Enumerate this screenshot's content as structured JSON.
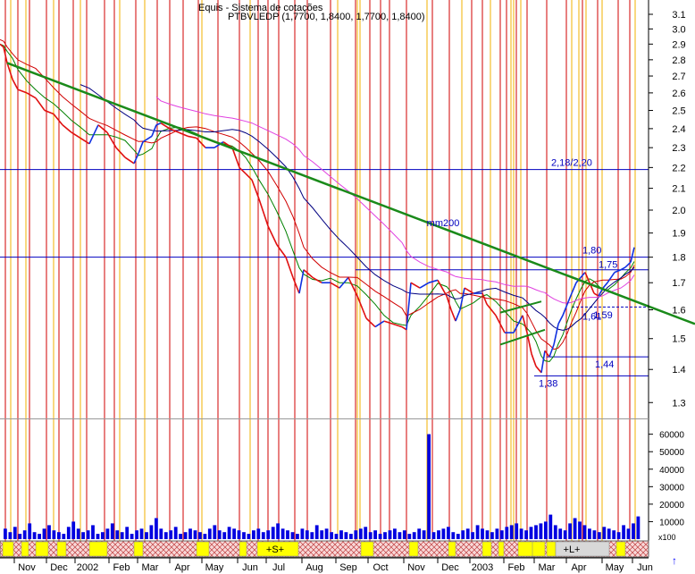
{
  "header": {
    "line1": "Equis - Sistema de cotações",
    "line2": "PTBVLEDP (1,7700, 1,8400, 1,7700, 1,8400)"
  },
  "chart_data": [
    {
      "type": "line",
      "title": "",
      "x_ticks": [
        "Nov",
        "Dec",
        "2002",
        "Feb",
        "Mar",
        "Apr",
        "May",
        "Jun",
        "Jul",
        "Aug",
        "Sep",
        "Oct",
        "Nov",
        "Dec",
        "2003",
        "Feb",
        "Mar",
        "Apr",
        "May",
        "Jun"
      ],
      "y_ticks": [
        "3.1",
        "3.0",
        "2.9",
        "2.8",
        "2.7",
        "2.6",
        "2.5",
        "2.4",
        "2.3",
        "2.2",
        "2.1",
        "2.0",
        "1.9",
        "1.8",
        "1.7",
        "1.6",
        "1.5",
        "1.4",
        "1.3"
      ],
      "ylim": [
        1.28,
        3.15
      ],
      "log_scale": true,
      "series": [
        {
          "color": "#e01010",
          "role": "price (down days)"
        },
        {
          "color": "#1030e0",
          "role": "price (up days)"
        },
        {
          "name": "mm200",
          "color": "#e040e0"
        },
        {
          "color": "#000080"
        },
        {
          "color": "#e01010"
        },
        {
          "color": "#008000"
        }
      ],
      "price_points": [
        [
          0,
          2.9
        ],
        [
          4,
          2.88
        ],
        [
          8,
          2.78
        ],
        [
          14,
          2.68
        ],
        [
          20,
          2.62
        ],
        [
          30,
          2.6
        ],
        [
          40,
          2.57
        ],
        [
          50,
          2.5
        ],
        [
          60,
          2.48
        ],
        [
          70,
          2.42
        ],
        [
          80,
          2.38
        ],
        [
          90,
          2.35
        ],
        [
          100,
          2.32
        ],
        [
          110,
          2.42
        ],
        [
          120,
          2.38
        ],
        [
          130,
          2.3
        ],
        [
          140,
          2.25
        ],
        [
          150,
          2.22
        ],
        [
          155,
          2.27
        ],
        [
          160,
          2.33
        ],
        [
          170,
          2.36
        ],
        [
          175,
          2.42
        ],
        [
          180,
          2.43
        ],
        [
          190,
          2.4
        ],
        [
          200,
          2.38
        ],
        [
          210,
          2.36
        ],
        [
          220,
          2.35
        ],
        [
          230,
          2.3
        ],
        [
          240,
          2.3
        ],
        [
          250,
          2.33
        ],
        [
          260,
          2.3
        ],
        [
          268,
          2.2
        ],
        [
          275,
          2.17
        ],
        [
          282,
          2.14
        ],
        [
          290,
          2.05
        ],
        [
          300,
          1.93
        ],
        [
          310,
          1.85
        ],
        [
          320,
          1.8
        ],
        [
          328,
          1.72
        ],
        [
          335,
          1.66
        ],
        [
          340,
          1.75
        ],
        [
          350,
          1.72
        ],
        [
          360,
          1.7
        ],
        [
          370,
          1.7
        ],
        [
          380,
          1.68
        ],
        [
          390,
          1.72
        ],
        [
          400,
          1.65
        ],
        [
          410,
          1.57
        ],
        [
          420,
          1.54
        ],
        [
          430,
          1.56
        ],
        [
          440,
          1.55
        ],
        [
          450,
          1.54
        ],
        [
          455,
          1.53
        ],
        [
          460,
          1.7
        ],
        [
          470,
          1.68
        ],
        [
          480,
          1.7
        ],
        [
          490,
          1.71
        ],
        [
          500,
          1.65
        ],
        [
          505,
          1.6
        ],
        [
          510,
          1.56
        ],
        [
          515,
          1.6
        ],
        [
          520,
          1.68
        ],
        [
          530,
          1.66
        ],
        [
          540,
          1.66
        ],
        [
          545,
          1.62
        ],
        [
          555,
          1.58
        ],
        [
          565,
          1.52
        ],
        [
          575,
          1.52
        ],
        [
          585,
          1.58
        ],
        [
          590,
          1.52
        ],
        [
          595,
          1.45
        ],
        [
          600,
          1.41
        ],
        [
          606,
          1.39
        ],
        [
          610,
          1.46
        ],
        [
          615,
          1.44
        ],
        [
          620,
          1.48
        ],
        [
          625,
          1.55
        ],
        [
          630,
          1.58
        ],
        [
          635,
          1.62
        ],
        [
          640,
          1.66
        ],
        [
          645,
          1.7
        ],
        [
          650,
          1.72
        ],
        [
          655,
          1.74
        ],
        [
          660,
          1.7
        ],
        [
          665,
          1.66
        ],
        [
          670,
          1.65
        ],
        [
          675,
          1.68
        ],
        [
          680,
          1.7
        ],
        [
          688,
          1.74
        ],
        [
          695,
          1.75
        ],
        [
          700,
          1.76
        ],
        [
          706,
          1.78
        ],
        [
          710,
          1.84
        ]
      ],
      "trendlines": [
        {
          "from": [
            8,
            2.78
          ],
          "to": [
            778,
            1.55
          ],
          "color": "#1a8a1a"
        },
        {
          "from": [
            560,
            1.48
          ],
          "to": [
            610,
            1.53
          ],
          "color": "#1a8a1a"
        },
        {
          "from": [
            560,
            1.59
          ],
          "to": [
            606,
            1.63
          ],
          "color": "#1a8a1a"
        }
      ],
      "horizontal_lines": [
        {
          "value": 2.19,
          "label": "2,18/2,20",
          "color": "#0000c0"
        },
        {
          "value": 1.8,
          "label": "1,80",
          "color": "#0000c0"
        },
        {
          "value": 1.75,
          "label": "1,75",
          "color": "#0000c0"
        },
        {
          "value": 1.61,
          "label": "1,61",
          "color": "#0000c0"
        },
        {
          "value": 1.44,
          "label": "1,44",
          "color": "#0000c0"
        },
        {
          "value": 1.38,
          "label": "1,38",
          "color": "#0000c0"
        }
      ],
      "annotations": [
        {
          "text": "mm200",
          "x": 496,
          "y": 1.93
        },
        {
          "text": "1,59",
          "x": 675,
          "y": 1.57
        }
      ]
    },
    {
      "type": "bar",
      "title": "",
      "y_ticks": [
        "60000",
        "50000",
        "40000",
        "30000",
        "20000",
        "10000"
      ],
      "ylim": [
        0,
        68000
      ],
      "values": [
        6000,
        4000,
        7000,
        3000,
        5000,
        9000,
        4000,
        3000,
        6000,
        8000,
        5000,
        4000,
        3000,
        7000,
        10000,
        6000,
        4000,
        5000,
        8000,
        3000,
        4000,
        6000,
        9000,
        5000,
        4000,
        7000,
        3000,
        5000,
        6000,
        4000,
        8000,
        12000,
        6000,
        4000,
        5000,
        7000,
        3000,
        4000,
        6000,
        5000,
        4000,
        3000,
        6000,
        8000,
        5000,
        4000,
        7000,
        6000,
        5000,
        4000,
        3000,
        5000,
        6000,
        4000,
        5000,
        7000,
        9000,
        6000,
        5000,
        4000,
        3000,
        6000,
        5000,
        4000,
        8000,
        5000,
        6000,
        4000,
        3000,
        5000,
        4000,
        3000,
        5000,
        6000,
        7000,
        4000,
        5000,
        3000,
        4000,
        5000,
        6000,
        4000,
        5000,
        3000,
        4000,
        6000,
        5000,
        60000,
        4000,
        5000,
        6000,
        7000,
        4000,
        3000,
        5000,
        6000,
        4000,
        8000,
        6000,
        5000,
        4000,
        6000,
        5000,
        7000,
        8000,
        9000,
        6000,
        5000,
        7000,
        8000,
        9000,
        10000,
        14000,
        8000,
        6000,
        5000,
        9000,
        12000,
        10000,
        8000,
        6000,
        5000,
        4000,
        7000,
        6000,
        5000,
        4000,
        8000,
        6000,
        9000,
        13000
      ],
      "volume_label": "x100"
    }
  ],
  "rsi_strip": {
    "labels": [
      {
        "text": "+S+",
        "x": 300
      },
      {
        "text": "+L+",
        "x": 632
      }
    ]
  },
  "vertical_lines": {
    "red": [
      6,
      20,
      33,
      52,
      66,
      82,
      97,
      117,
      128,
      152,
      176,
      190,
      205,
      222,
      244,
      268,
      289,
      300,
      312,
      330,
      344,
      370,
      398,
      414,
      426,
      436,
      455,
      484,
      503,
      528,
      540,
      560,
      567,
      578,
      590,
      612,
      634,
      652,
      669,
      692,
      705
    ],
    "orange": [
      12,
      29,
      60,
      90,
      134,
      162,
      226,
      280,
      378,
      400,
      403,
      478,
      517,
      549,
      572,
      575,
      583,
      640,
      648,
      656,
      674,
      711
    ]
  },
  "colors": {
    "ma_green": "#008000",
    "ma_red": "#d00000",
    "ma_navy": "#000080",
    "ma_magenta": "#e040e0",
    "price_down": "#e01010",
    "price_up": "#1030e0",
    "trend": "#1a8a1a",
    "vline_red": "#d00000",
    "vline_orange": "#f0b000",
    "strip_yellow": "#ffff00",
    "volume": "#0000e0"
  }
}
